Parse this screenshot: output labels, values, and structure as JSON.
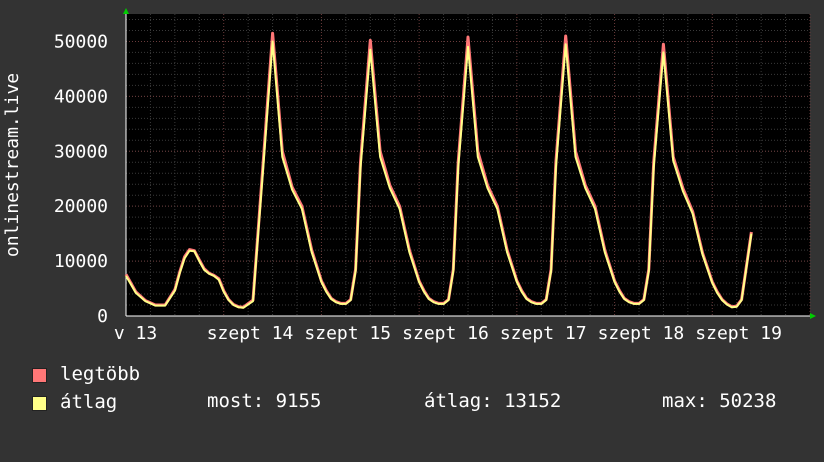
{
  "chart_data": {
    "type": "line",
    "ylabel": "onlinestream.live",
    "ylim": [
      0,
      55000
    ],
    "yticks": [
      0,
      10000,
      20000,
      30000,
      40000,
      50000
    ],
    "ytick_labels": [
      "0",
      "10000",
      "20000",
      "30000",
      "40000",
      "50000"
    ],
    "xlim": [
      0,
      7
    ],
    "xticks": [
      0.05,
      1,
      2,
      3,
      4,
      5,
      6
    ],
    "xtick_labels": [
      "v 13",
      "szept 14",
      "szept 15",
      "szept 16",
      "szept 17",
      "szept 18",
      "szept 19"
    ],
    "grid": true,
    "x": [
      0,
      0.1,
      0.2,
      0.3,
      0.4,
      0.5,
      0.55,
      0.6,
      0.65,
      0.7,
      0.75,
      0.8,
      0.85,
      0.9,
      0.95,
      1.0,
      1.05,
      1.1,
      1.15,
      1.2,
      1.3,
      1.4,
      1.5,
      1.6,
      1.7,
      1.8,
      1.9,
      2.0,
      2.05,
      2.1,
      2.15,
      2.2,
      2.25,
      2.3,
      2.35,
      2.4,
      2.5,
      2.6,
      2.7,
      2.8,
      2.9,
      3.0,
      3.05,
      3.1,
      3.15,
      3.2,
      3.25,
      3.3,
      3.35,
      3.4,
      3.5,
      3.6,
      3.7,
      3.8,
      3.9,
      4.0,
      4.05,
      4.1,
      4.15,
      4.2,
      4.25,
      4.3,
      4.35,
      4.4,
      4.5,
      4.6,
      4.7,
      4.8,
      4.9,
      5.0,
      5.05,
      5.1,
      5.15,
      5.2,
      5.25,
      5.3,
      5.35,
      5.4,
      5.5,
      5.6,
      5.7,
      5.8,
      5.9,
      6.0,
      6.05,
      6.1,
      6.15,
      6.2,
      6.25,
      6.3,
      6.4
    ],
    "series": [
      {
        "name": "legtöbb",
        "color": "#ff7777",
        "values": [
          7600,
          4400,
          2800,
          2000,
          2000,
          4800,
          8000,
          10800,
          12100,
          11900,
          10200,
          8600,
          7800,
          7400,
          6800,
          4600,
          3000,
          2100,
          1700,
          1600,
          2900,
          27000,
          51500,
          30000,
          23500,
          20000,
          12000,
          6400,
          4600,
          3200,
          2600,
          2300,
          2300,
          3000,
          8500,
          28000,
          50200,
          30000,
          23800,
          20000,
          12000,
          6400,
          4600,
          3200,
          2600,
          2300,
          2300,
          3000,
          8500,
          28000,
          50800,
          30000,
          23800,
          20000,
          12000,
          6400,
          4600,
          3200,
          2600,
          2300,
          2300,
          3000,
          8500,
          28000,
          51000,
          30000,
          23800,
          20000,
          12000,
          6400,
          4600,
          3200,
          2600,
          2300,
          2300,
          3000,
          8500,
          28000,
          49500,
          29000,
          23200,
          19000,
          11500,
          6200,
          4400,
          3000,
          2200,
          1700,
          1800,
          3000,
          15300
        ]
      },
      {
        "name": "átlag",
        "color": "#ffff88",
        "values": [
          7300,
          4200,
          2700,
          1900,
          1900,
          4600,
          7800,
          10500,
          11900,
          11800,
          10000,
          8400,
          7700,
          7300,
          6600,
          4400,
          2900,
          2000,
          1600,
          1500,
          2700,
          26000,
          50000,
          29000,
          23000,
          19500,
          11600,
          6200,
          4400,
          3100,
          2500,
          2200,
          2200,
          2900,
          8200,
          27000,
          48500,
          29000,
          23300,
          19500,
          11600,
          6200,
          4400,
          3100,
          2500,
          2200,
          2200,
          2900,
          8200,
          27000,
          49000,
          29000,
          23300,
          19500,
          11600,
          6200,
          4400,
          3100,
          2500,
          2200,
          2200,
          2900,
          8200,
          27000,
          49500,
          29000,
          23300,
          19500,
          11600,
          6200,
          4400,
          3100,
          2500,
          2200,
          2200,
          2900,
          8200,
          27000,
          48000,
          28300,
          22700,
          18600,
          11200,
          6000,
          4200,
          2900,
          2100,
          1600,
          1700,
          2900,
          15000
        ]
      }
    ]
  },
  "legend": {
    "items": [
      {
        "label": "legtöbb",
        "color": "#ff7777"
      },
      {
        "label": "átlag",
        "color": "#ffff88"
      }
    ]
  },
  "stats": {
    "most": "most: 9155",
    "atlag": "átlag: 13152",
    "max": "max: 50238"
  }
}
